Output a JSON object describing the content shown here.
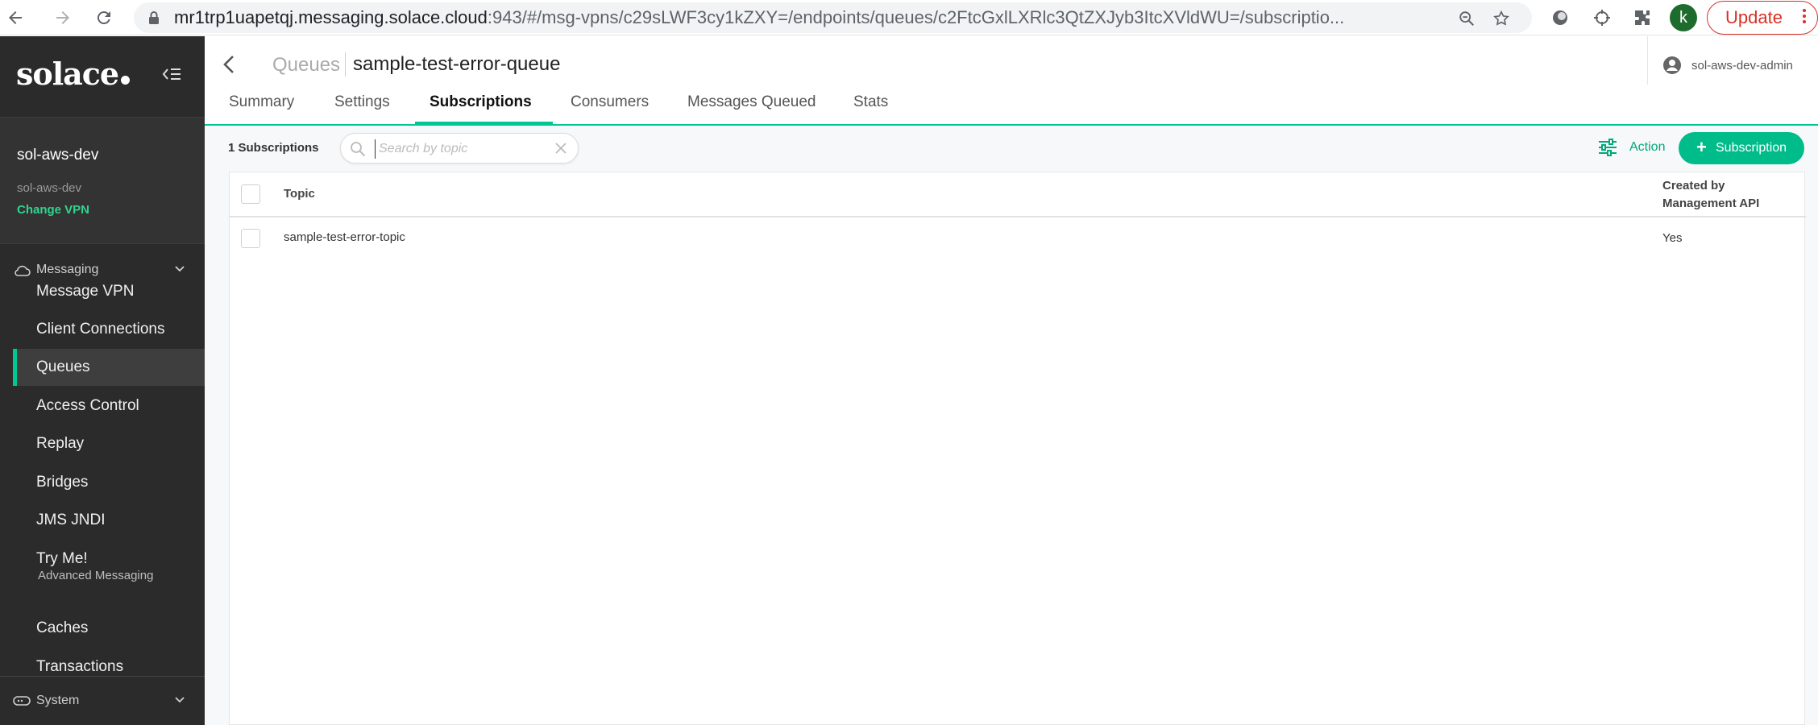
{
  "browser": {
    "url_host": "mr1trp1uapetqj.messaging.solace.cloud",
    "url_path": ":943/#/msg-vpns/c29sLWF3cy1kZXY=/endpoints/queues/c2FtcGxlLXRlc3QtZXJyb3ItcXVldWU=/subscriptio...",
    "profile_initial": "k",
    "update_label": "Update"
  },
  "sidebar": {
    "logo": "solace",
    "vpn": {
      "name": "sol-aws-dev",
      "sub": "sol-aws-dev",
      "change_label": "Change VPN"
    },
    "sections": {
      "messaging": "Messaging",
      "advanced": "Advanced Messaging",
      "system": "System"
    },
    "items": [
      {
        "label": "Message VPN"
      },
      {
        "label": "Client Connections"
      },
      {
        "label": "Queues"
      },
      {
        "label": "Access Control"
      },
      {
        "label": "Replay"
      },
      {
        "label": "Bridges"
      },
      {
        "label": "JMS JNDI"
      },
      {
        "label": "Try Me!"
      },
      {
        "label": "Caches"
      },
      {
        "label": "Transactions"
      }
    ]
  },
  "header": {
    "breadcrumb": "Queues",
    "title": "sample-test-error-queue",
    "user": "sol-aws-dev-admin"
  },
  "tabs": [
    {
      "label": "Summary"
    },
    {
      "label": "Settings"
    },
    {
      "label": "Subscriptions"
    },
    {
      "label": "Consumers"
    },
    {
      "label": "Messages Queued"
    },
    {
      "label": "Stats"
    }
  ],
  "toolbar": {
    "count": "1 Subscriptions",
    "search_placeholder": "Search by topic",
    "search_value": "",
    "action_label": "Action",
    "add_label": "Subscription"
  },
  "table": {
    "columns": [
      "Topic",
      "Created by Management API"
    ],
    "rows": [
      {
        "topic": "sample-test-error-topic",
        "created": "Yes"
      }
    ]
  },
  "colors": {
    "accent": "#00c895",
    "sidebar_bg": "#2b2b2b",
    "change_vpn": "#2fd48f",
    "update": "#d93025"
  }
}
